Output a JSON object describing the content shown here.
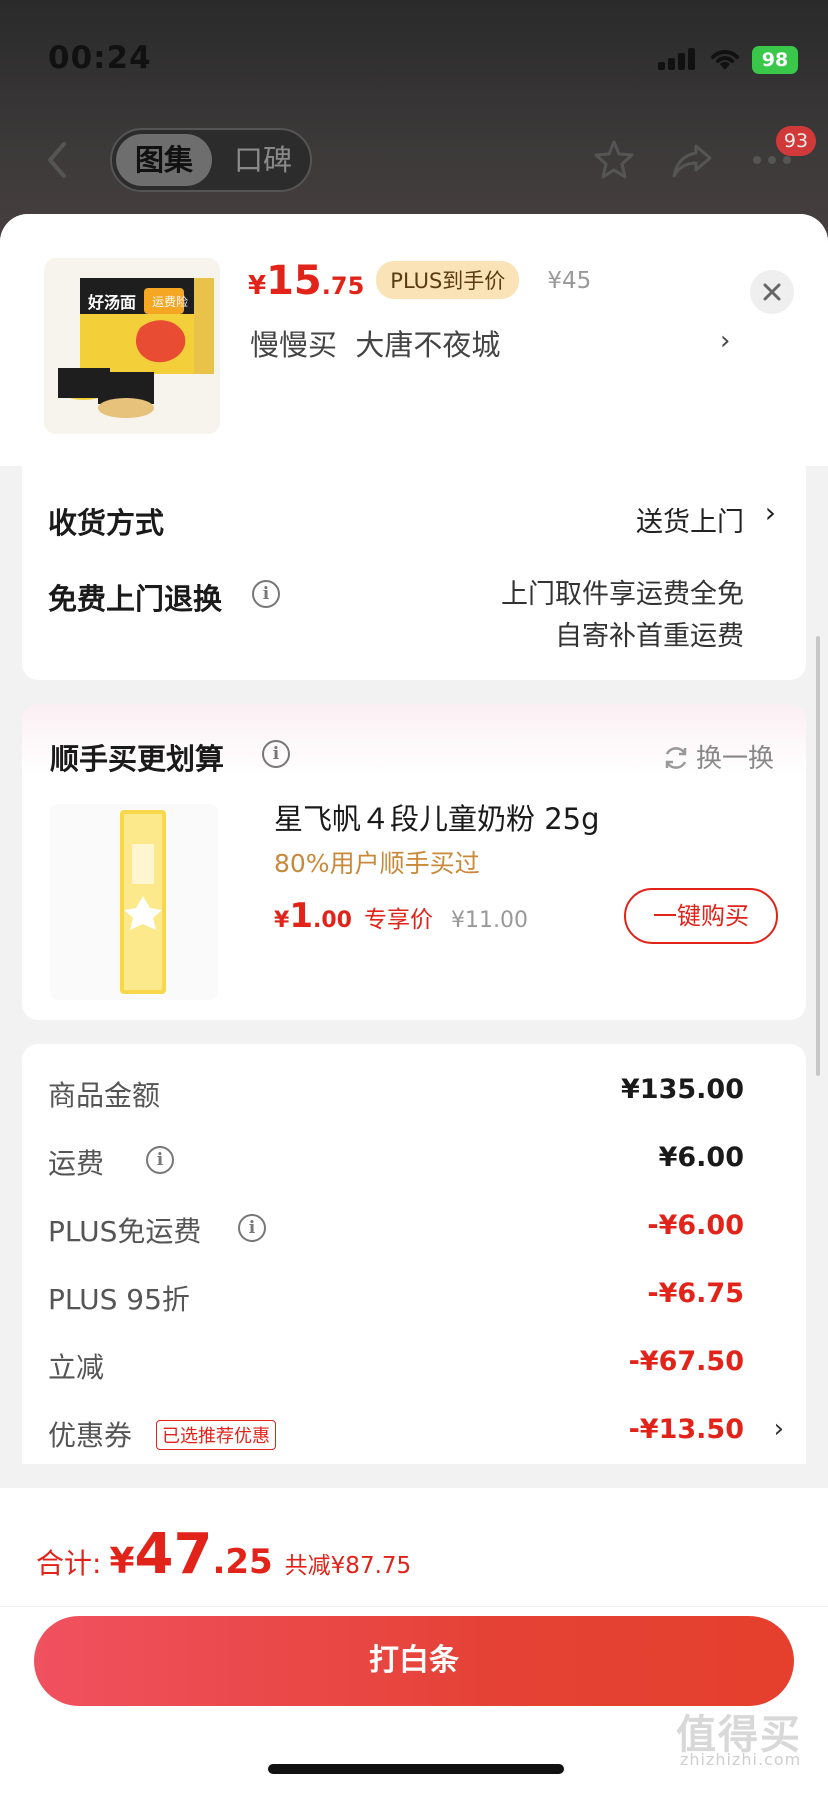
{
  "status_bar": {
    "time": "00:24",
    "battery": "98"
  },
  "nav": {
    "tabs": [
      {
        "label": "图集",
        "active": true
      },
      {
        "label": "口碑",
        "active": false
      }
    ],
    "more_badge": "93"
  },
  "product": {
    "price_symbol": "¥",
    "price_int": "15",
    "price_dec": ".75",
    "plus_tag": "PLUS到手价",
    "original_price": "¥45",
    "shop_line": "慢慢买  大唐不夜城",
    "thumb_texts": {
      "brand": "好汤面",
      "badge": "运费险"
    }
  },
  "delivery": {
    "method_label": "收货方式",
    "method_value": "送货上门",
    "return_label": "免费上门退换",
    "return_line1": "上门取件享运费全免",
    "return_line2": "自寄补首重运费"
  },
  "addon": {
    "title": "顺手买更划算",
    "refresh_label": "换一换",
    "name": "星飞帆４段儿童奶粉 25g",
    "subtitle": "80%用户顺手买过",
    "price_symbol": "¥",
    "price_int": "1",
    "price_dec": ".00",
    "price_tag": "专享价",
    "original_price": "¥11.00",
    "buy_label": "一键购买"
  },
  "summary": {
    "rows": [
      {
        "label": "商品金额",
        "value": "¥135.00"
      },
      {
        "label": "运费",
        "value": "¥6.00"
      },
      {
        "label": "PLUS免运费",
        "value": "-¥6.00"
      },
      {
        "label": "PLUS 95折",
        "value": "-¥6.75"
      },
      {
        "label": "立减",
        "value": "-¥67.50"
      },
      {
        "label": "优惠券",
        "value": "-¥13.50",
        "tag": "已选推荐优惠"
      }
    ]
  },
  "footer": {
    "total_label": "合计:",
    "total_symbol": "¥",
    "total_int": "47",
    "total_dec": ".25",
    "total_saved": "共减¥87.75",
    "pay_label": "打白条"
  },
  "colors": {
    "accent": "#e2231a",
    "plus_tag_bg": "#fbe3b8",
    "addon_subtitle": "#c8893a"
  },
  "watermark": {
    "main": "值得买",
    "sub": "zhizhizhi.com"
  }
}
